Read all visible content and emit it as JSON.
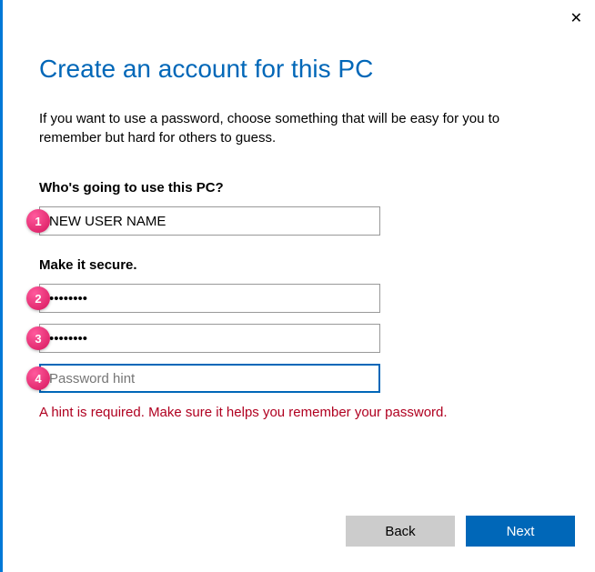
{
  "close_icon": "✕",
  "title": "Create an account for this PC",
  "description": "If you want to use a password, choose something that will be easy for you to remember but hard for others to guess.",
  "who_label": "Who's going to use this PC?",
  "username_value": "NEW USER NAME",
  "secure_label": "Make it secure.",
  "password_value": "••••••••",
  "confirm_value": "••••••••",
  "hint_placeholder": "Password hint",
  "hint_value": "",
  "error_message": "A hint is required. Make sure it helps you remember your password.",
  "back_label": "Back",
  "next_label": "Next",
  "badges": {
    "b1": "1",
    "b2": "2",
    "b3": "3",
    "b4": "4"
  }
}
